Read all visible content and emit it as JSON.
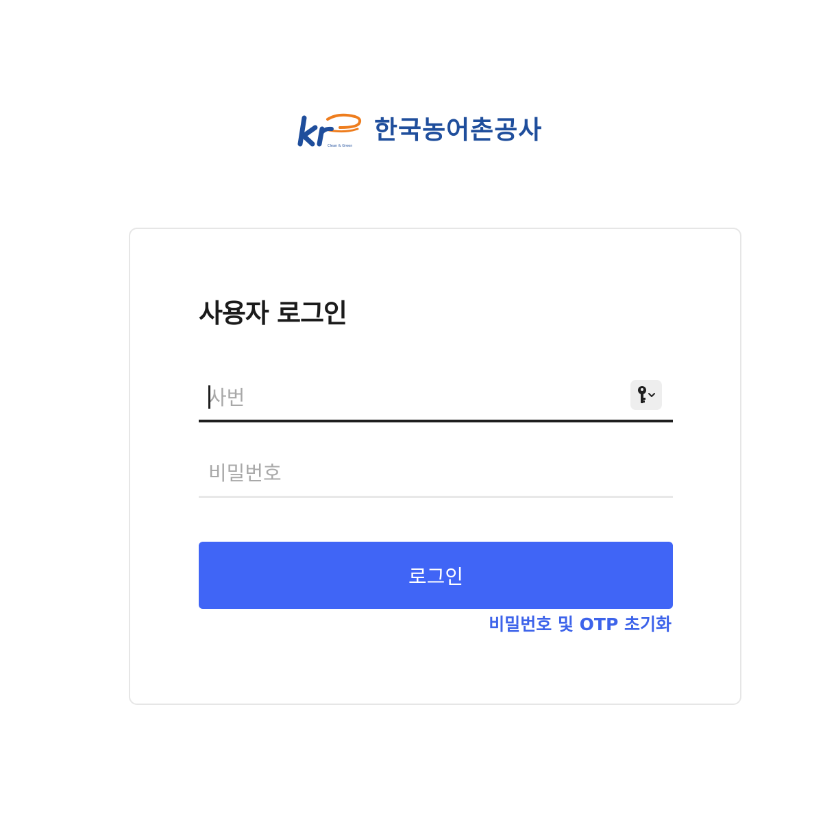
{
  "logo": {
    "mark_text": "kr",
    "mark_tagline": "Clean & Green",
    "org_name": "한국농어촌공사",
    "colors": {
      "navy": "#1f4e9c",
      "orange": "#ee7d1e"
    }
  },
  "login": {
    "title": "사용자 로그인",
    "id_field": {
      "placeholder": "사번",
      "value": ""
    },
    "password_field": {
      "placeholder": "비밀번호",
      "value": ""
    },
    "key_button_icon": "key-icon",
    "submit_label": "로그인",
    "reset_link_label": "비밀번호 및 OTP 초기화"
  },
  "colors": {
    "accent": "#4065f6",
    "link": "#3d63ea",
    "title": "#1b1b1b",
    "placeholder": "#a8a8a8"
  }
}
